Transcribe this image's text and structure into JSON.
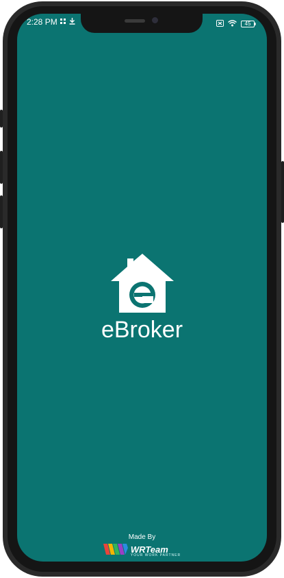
{
  "status_bar": {
    "time": "2:28 PM",
    "battery": "45"
  },
  "app": {
    "name": "eBroker",
    "logo_letter": "e"
  },
  "footer": {
    "made_by": "Made By",
    "brand": "WRTeam",
    "tagline": "YOUR WORK PARTNER"
  },
  "colors": {
    "background": "#0b7471",
    "text": "#ffffff"
  }
}
